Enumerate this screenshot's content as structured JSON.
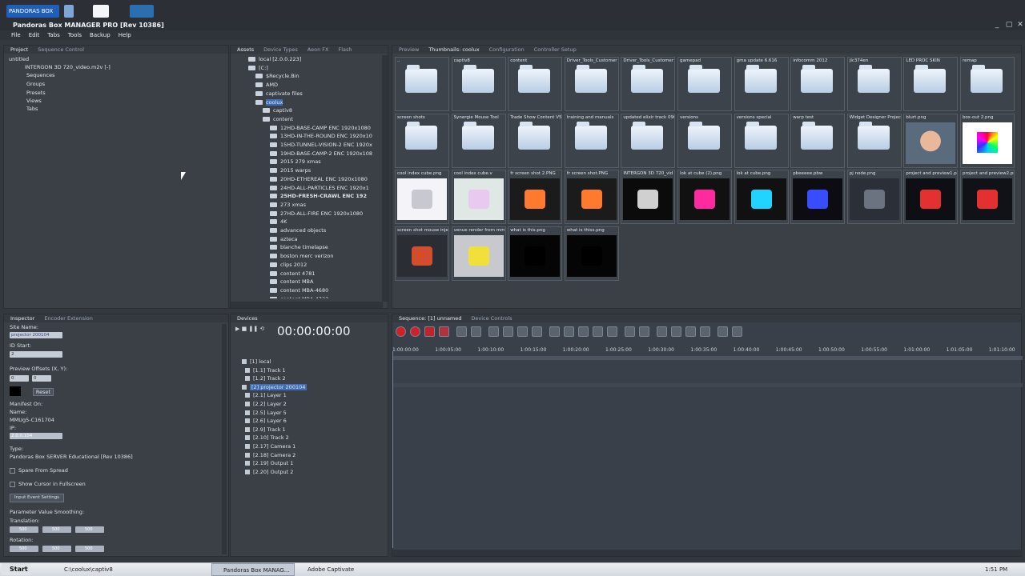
{
  "app": {
    "title": "Pandoras Box MANAGER PRO [Rev 10386]",
    "launcher_label": "PANDORAS BOX"
  },
  "menu": [
    "File",
    "Edit",
    "Tabs",
    "Tools",
    "Backup",
    "Help"
  ],
  "project_panel": {
    "tabs": [
      "Project",
      "Sequence Control"
    ],
    "items": [
      "untitled",
      "INTERGON 3D 720_video.m2v [-]",
      "Sequences",
      "Groups",
      "Presets",
      "Views",
      "Tabs"
    ]
  },
  "assets_panel": {
    "tabs": [
      "Assets",
      "Device Types",
      "Aeon FX",
      "Flash"
    ],
    "tree": [
      "local [2.0.0.223]",
      "[C:]",
      "$Recycle.Bin",
      "AMD",
      "captivate files",
      "coolux",
      "captiv8",
      "content",
      "12HD-BASE-CAMP ENC 1920x1080",
      "13HD-IN-THE-ROUND ENC 1920x10",
      "15HD-TUNNEL-VISION-2 ENC 1920x",
      "19HD-BASE-CAMP-2 ENC 1920x108",
      "2015 279 xmas",
      "2015 warps",
      "20HD-ETHEREAL ENC 1920x1080",
      "24HD-ALL-PARTICLES ENC 1920x1",
      "25HD-FRESH-CRAWL ENC 192",
      "273 xmas",
      "27HD-ALL-FIRE ENC 1920x1080",
      "4K",
      "advanced objects",
      "azteca",
      "blanche timelapse",
      "boston merc verizon",
      "clips 2012",
      "content 4781",
      "content MBA",
      "content MBA-4680",
      "content MBA-4733"
    ]
  },
  "thumbs_panel": {
    "tabs": [
      "Preview",
      "Thumbnails: coolux",
      "Configuration",
      "Controller Setup"
    ],
    "items": [
      "..",
      "captiv8",
      "content",
      "Driver_Tools_Customer",
      "Driver_Tools_Customer",
      "gamepad",
      "gma update 6.616",
      "infocomm 2012",
      "jlc374en",
      "LED PROC SKIN",
      "remap",
      "screen shots",
      "Synergie Mouse Tool",
      "Trade Show Content V5",
      "training and manuals",
      "updated elixir track 0904",
      "versions",
      "versions special",
      "warp test",
      "Widget Designer Project",
      "blurt.png",
      "box-out 2.png",
      "cool index cube.png",
      "cool index cube.v",
      "fr screen shot 2.PNG",
      "fr screen shot.PNG",
      "INTERGON 3D 720_vid",
      "lok at cube (2).png",
      "lok at cube.png",
      "pbeeeee.pbw",
      "pj node.png",
      "project and preview1.pn",
      "project and preview2.pn",
      "screen shot mouse injec",
      "venue render from mmL",
      "what is this.png",
      "what is thisx.png"
    ]
  },
  "inspector": {
    "tabs": [
      "Inspector",
      "Encoder Extension"
    ],
    "site_name_label": "Site Name:",
    "site_name_value": "projector 200104",
    "id_start_label": "ID Start:",
    "id_start_value": "2",
    "preview_offsets_label": "Preview Offsets (X, Y):",
    "offset_x": "0",
    "offset_y": "0",
    "reset_label": "Reset",
    "manifest_label": "Manifest On:",
    "name_label": "Name:",
    "name_value": "MMUg5-C161704",
    "ip_label": "IP:",
    "ip_value": "2.0.0.104",
    "type_label": "Type:",
    "type_value": "Pandoras Box SERVER Educational [Rev 10386]",
    "spare_label": "Spare From Spread",
    "cursor_label": "Show Cursor in Fullscreen",
    "input_events_label": "Input Event Settings",
    "smoothing_label": "Parameter Value Smoothing:",
    "translation_label": "Translation:",
    "rotation_label": "Rotation:",
    "smoothing_values": "500"
  },
  "devices": {
    "tab": "Devices",
    "timecode": "00:00:00:00",
    "rows": [
      "[1] local",
      "[1.1] Track 1",
      "[1.2] Track 2",
      "[2] projector 200104",
      "[2.1] Layer 1",
      "[2.2] Layer 2",
      "[2.5] Layer 5",
      "[2.6] Layer 6",
      "[2.9] Track 1",
      "[2.10] Track 2",
      "[2.17] Camera 1",
      "[2.18] Camera 2",
      "[2.19] Output 1",
      "[2.20] Output 2"
    ]
  },
  "sequence": {
    "tabs": [
      "Sequence: [1] unnamed",
      "Device Controls"
    ],
    "ruler": [
      "1:00:00:00",
      "1:00:05:00",
      "1:00:10:00",
      "1:00:15:00",
      "1:00:20:00",
      "1:00:25:00",
      "1:00:30:00",
      "1:00:35:00",
      "1:00:40:00",
      "1:00:45:00",
      "1:00:50:00",
      "1:00:55:00",
      "1:01:00:00",
      "1:01:05:00",
      "1:01:10:00"
    ]
  },
  "taskbar": {
    "start": "Start",
    "items": [
      "C:\\coolux\\captiv8",
      "Pandoras Box MANAG...",
      "Adobe Captivate"
    ],
    "time": "1:51 PM"
  }
}
